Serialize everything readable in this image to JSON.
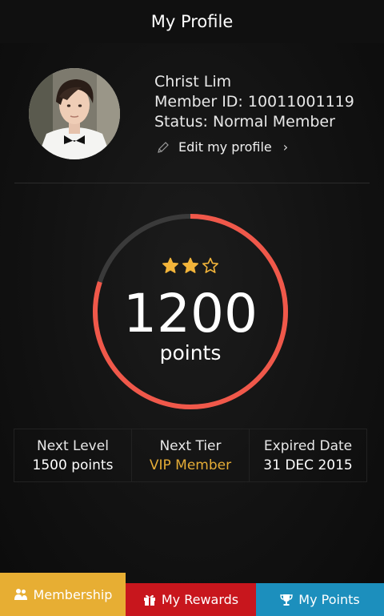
{
  "header": {
    "title": "My Profile"
  },
  "profile": {
    "name": "Christ Lim",
    "member_id": "Member ID: 10011001119",
    "status": "Status: Normal Member",
    "edit_label": "Edit my profile",
    "avatar_icon": "avatar-photo",
    "edit_icon": "pencil-icon",
    "edit_chevron": "›"
  },
  "points": {
    "value": "1200",
    "label": "points",
    "progress_fraction": 0.8,
    "stars_filled": 2,
    "stars_total": 3
  },
  "stats": [
    {
      "label": "Next Level",
      "value": "1500 points"
    },
    {
      "label": "Next Tier",
      "value": "VIP Member"
    },
    {
      "label": "Expired Date",
      "value": "31 DEC 2015"
    }
  ],
  "tabs": [
    {
      "label": "Membership",
      "icon": "members-icon",
      "color": "#e7ae33",
      "active": true
    },
    {
      "label": "My Rewards",
      "icon": "gift-icon",
      "color": "#c8161d",
      "active": false
    },
    {
      "label": "My Points",
      "icon": "trophy-icon",
      "color": "#1c8fbd",
      "active": false
    }
  ],
  "colors": {
    "ring_progress": "#f0584a",
    "ring_track": "#3a3a3a",
    "star": "#f2b43a",
    "tier_accent": "#e5ac36"
  }
}
